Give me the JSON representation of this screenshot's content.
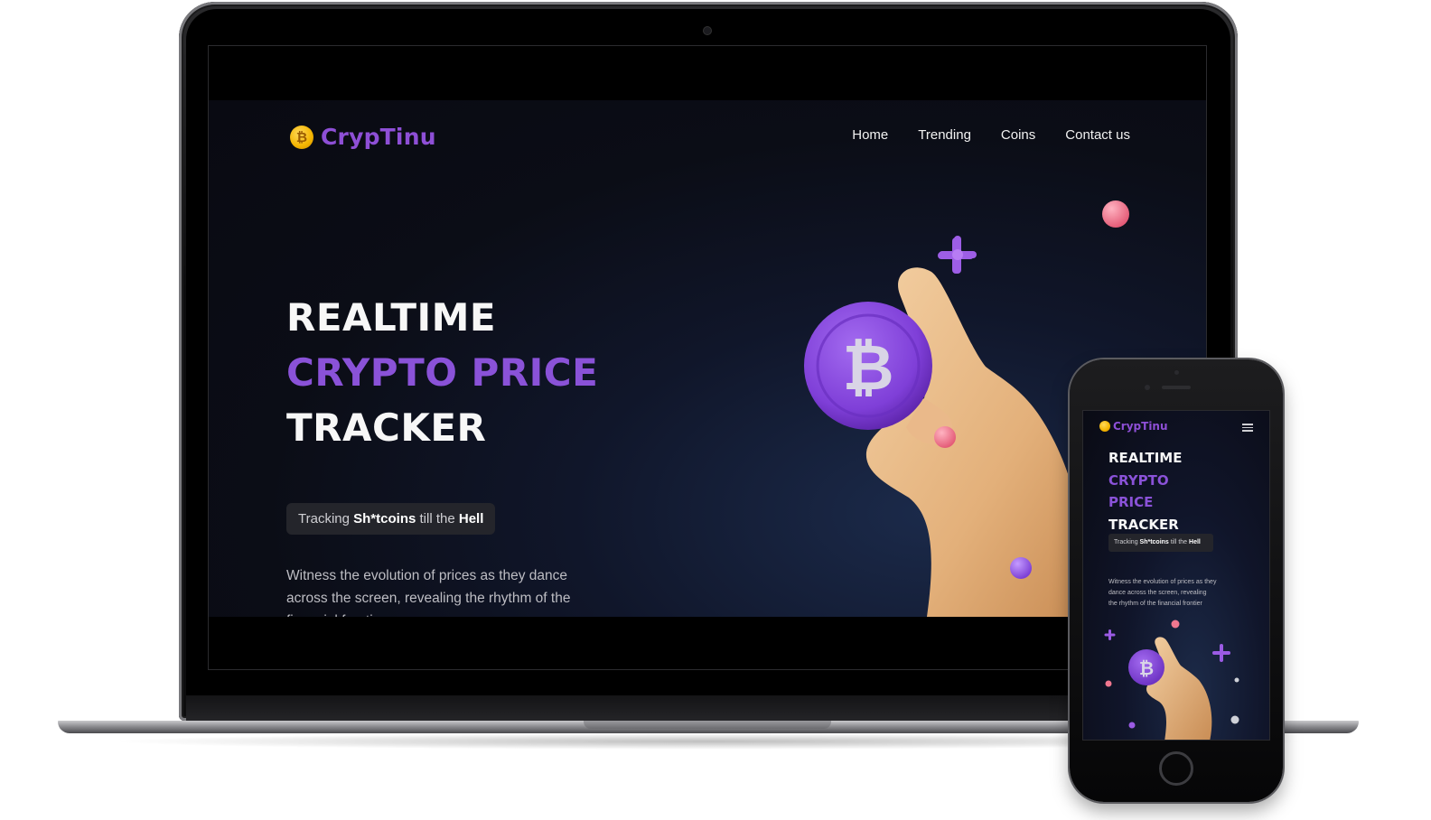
{
  "laptop": {
    "brand": {
      "logo_glyph": "₿",
      "name": "CrypTinu"
    },
    "nav": [
      {
        "label": "Home"
      },
      {
        "label": "Trending"
      },
      {
        "label": "Coins"
      },
      {
        "label": "Contact us"
      }
    ],
    "hero": {
      "line1": "REALTIME",
      "line2": "CRYPTO PRICE",
      "line3": "TRACKER",
      "tagline_prefix": "Tracking ",
      "tagline_bold1": "Sh*tcoins",
      "tagline_mid": " till the ",
      "tagline_bold2": "Hell",
      "description": "Witness the evolution of prices as they dance across the screen, revealing the rhythm of the financial frontier"
    },
    "illustration": {
      "coin_glyph": "₿",
      "icon": "hand-holding-bitcoin-icon"
    }
  },
  "phone": {
    "brand": {
      "name": "CrypTinu"
    },
    "hero": {
      "line1": "REALTIME",
      "line2": "CRYPTO",
      "line3": "PRICE",
      "line4": "TRACKER",
      "tagline_prefix": "Tracking ",
      "tagline_bold1": "Sh*tcoins",
      "tagline_mid": " till the ",
      "tagline_bold2": "Hell",
      "description": "Witness the evolution of prices as they dance across the screen, revealing the rhythm of the financial frontier"
    },
    "illustration": {
      "coin_glyph": "₿"
    }
  },
  "colors": {
    "accent_purple": "#8a52d8",
    "background": "#0b0d16",
    "logo_gold": "#f4b400",
    "ball_pink": "#f0778f"
  }
}
